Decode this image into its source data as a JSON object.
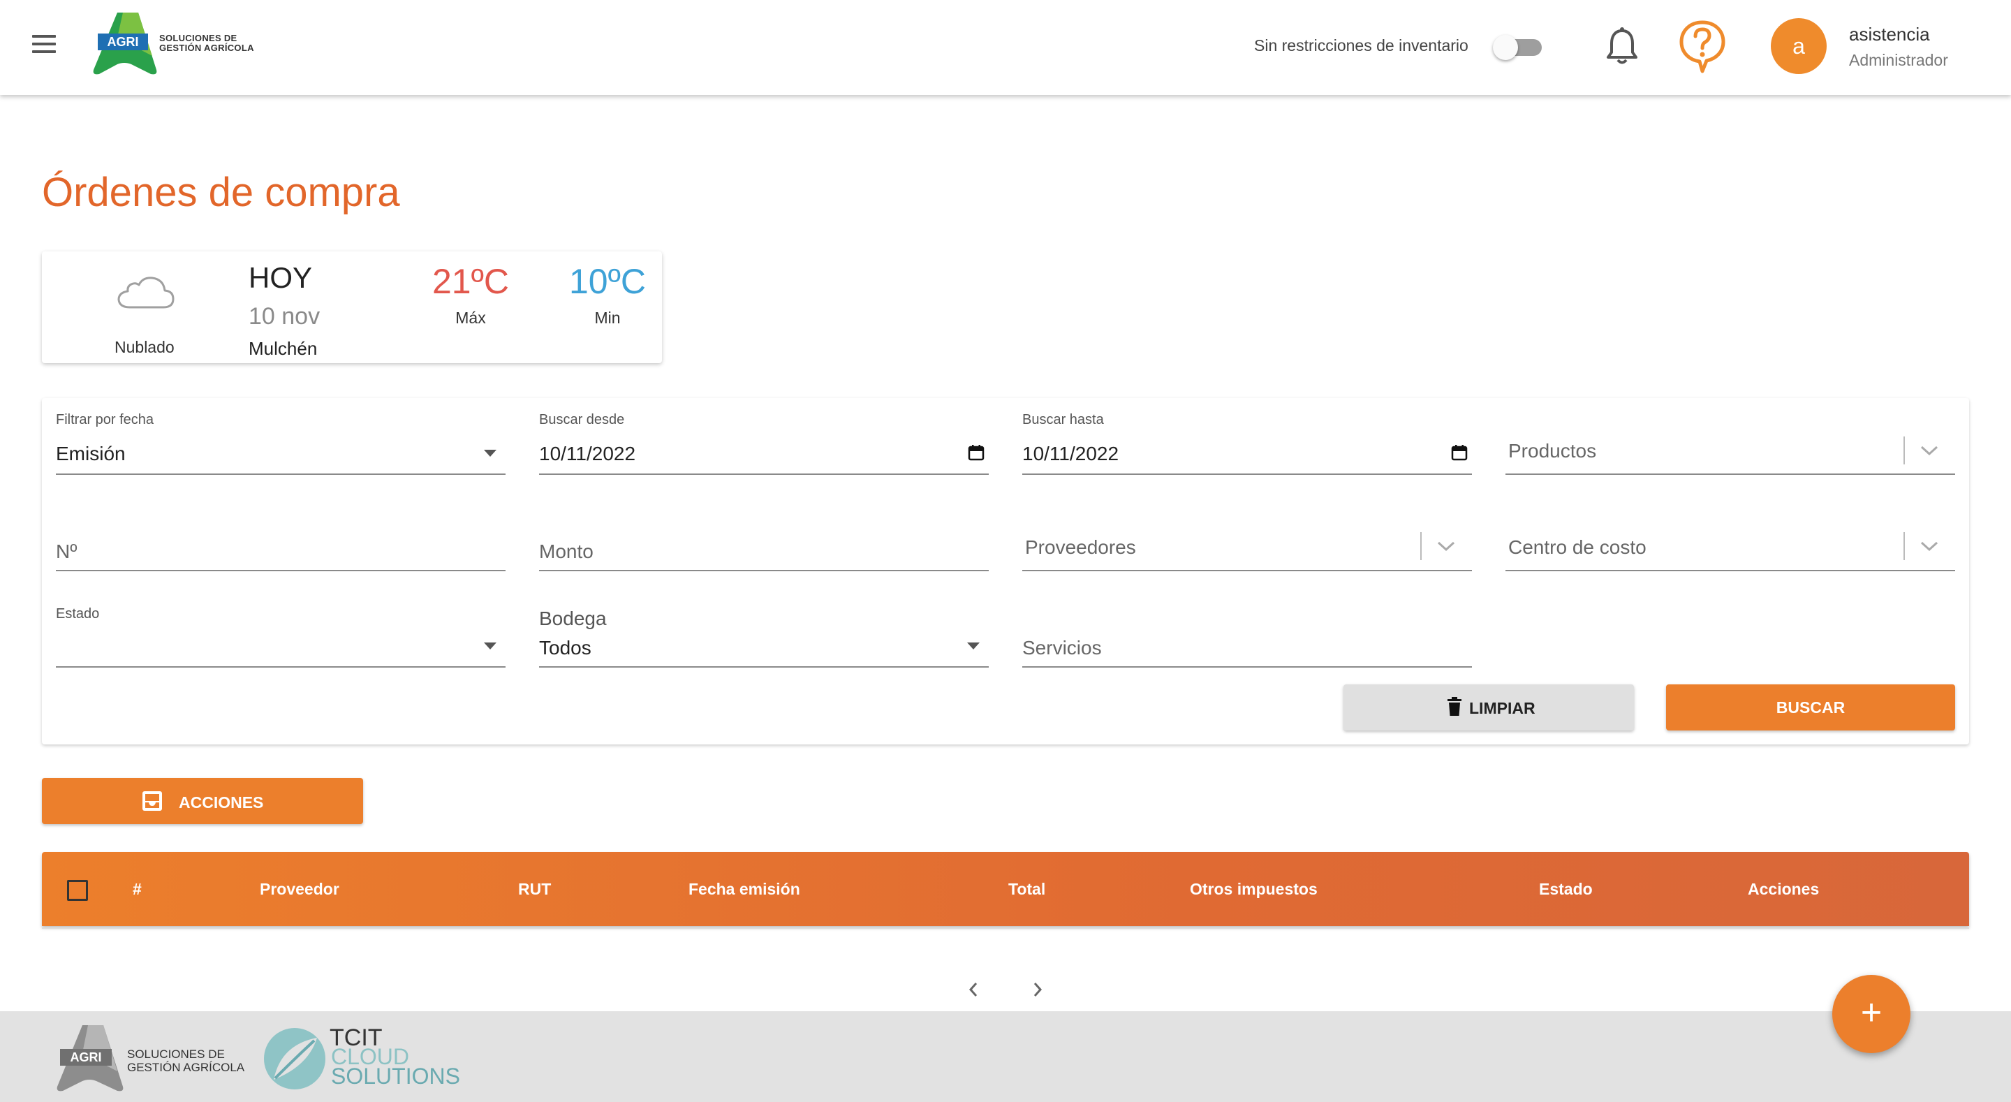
{
  "header": {
    "logo_text_line1": "SOLUCIONES DE",
    "logo_text_line2": "GESTIÓN AGRÍCOLA",
    "logo_badge": "AGRI",
    "toggle_label": "Sin restricciones de inventario",
    "toggle_on": false,
    "avatar_letter": "a",
    "user_name": "asistencia",
    "user_role": "Administrador",
    "icons": [
      "menu-icon",
      "bell-icon",
      "help-icon"
    ]
  },
  "page": {
    "title": "Órdenes de compra"
  },
  "weather": {
    "condition": "Nublado",
    "today": "HOY",
    "date": "10 nov",
    "city": "Mulchén",
    "max_temp": "21ºC",
    "max_label": "Máx",
    "min_temp": "10ºC",
    "min_label": "Min",
    "icon": "cloud-icon"
  },
  "filters": {
    "filter_by_date": {
      "label": "Filtrar por fecha",
      "value": "Emisión"
    },
    "search_from": {
      "label": "Buscar desde",
      "value": "10/11/2022"
    },
    "search_to": {
      "label": "Buscar hasta",
      "value": "10/11/2022"
    },
    "products": {
      "placeholder": "Productos"
    },
    "number": {
      "placeholder": "Nº"
    },
    "amount": {
      "placeholder": "Monto"
    },
    "suppliers": {
      "placeholder": "Proveedores"
    },
    "cost_center": {
      "placeholder": "Centro de costo"
    },
    "status": {
      "label": "Estado",
      "value": ""
    },
    "warehouse": {
      "label": "Bodega",
      "value": "Todos"
    },
    "services": {
      "placeholder": "Servicios"
    },
    "clear_label": "LIMPIAR",
    "search_label": "BUSCAR"
  },
  "actions": {
    "label": "ACCIONES"
  },
  "table": {
    "columns": [
      "#",
      "Proveedor",
      "RUT",
      "Fecha emisión",
      "Total",
      "Otros impuestos",
      "Estado",
      "Acciones"
    ],
    "rows": []
  },
  "footer": {
    "logo1_badge": "AGRI",
    "logo1_line1": "SOLUCIONES DE",
    "logo1_line2": "GESTIÓN AGRÍCOLA",
    "logo2_line1": "TCIT",
    "logo2_line2": "CLOUD",
    "logo2_line3": "SOLUTIONS"
  },
  "fab_label": "+",
  "colors": {
    "accent": "#ec7f2c",
    "title": "#e2662a",
    "max_temp": "#e2574c",
    "min_temp": "#3ea2d7"
  }
}
